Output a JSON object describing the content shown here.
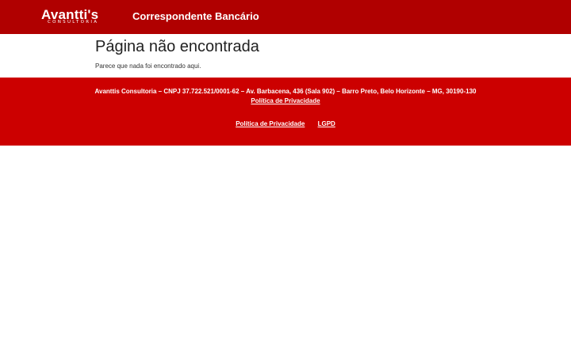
{
  "header": {
    "logo_main": "Avantti's",
    "logo_sub": "CONSULTORIA",
    "site_title": "Correspondente Bancário",
    "background_color": "#b00000"
  },
  "main": {
    "heading": "Página não encontrada",
    "message": "Parece que nada foi encontrado aqui."
  },
  "footer": {
    "background_color": "#cc0000",
    "company_info": "Avanttis Consultoria – CNPJ 37.722.521/0001-62 – Av. Barbacena, 436 (Sala 902) – Barro Preto, Belo Horizonte – MG, 30190-130",
    "info_privacy_link": "Política de Privacidade",
    "links": [
      {
        "label": "Política de Privacidade"
      },
      {
        "label": "LGPD"
      }
    ]
  }
}
